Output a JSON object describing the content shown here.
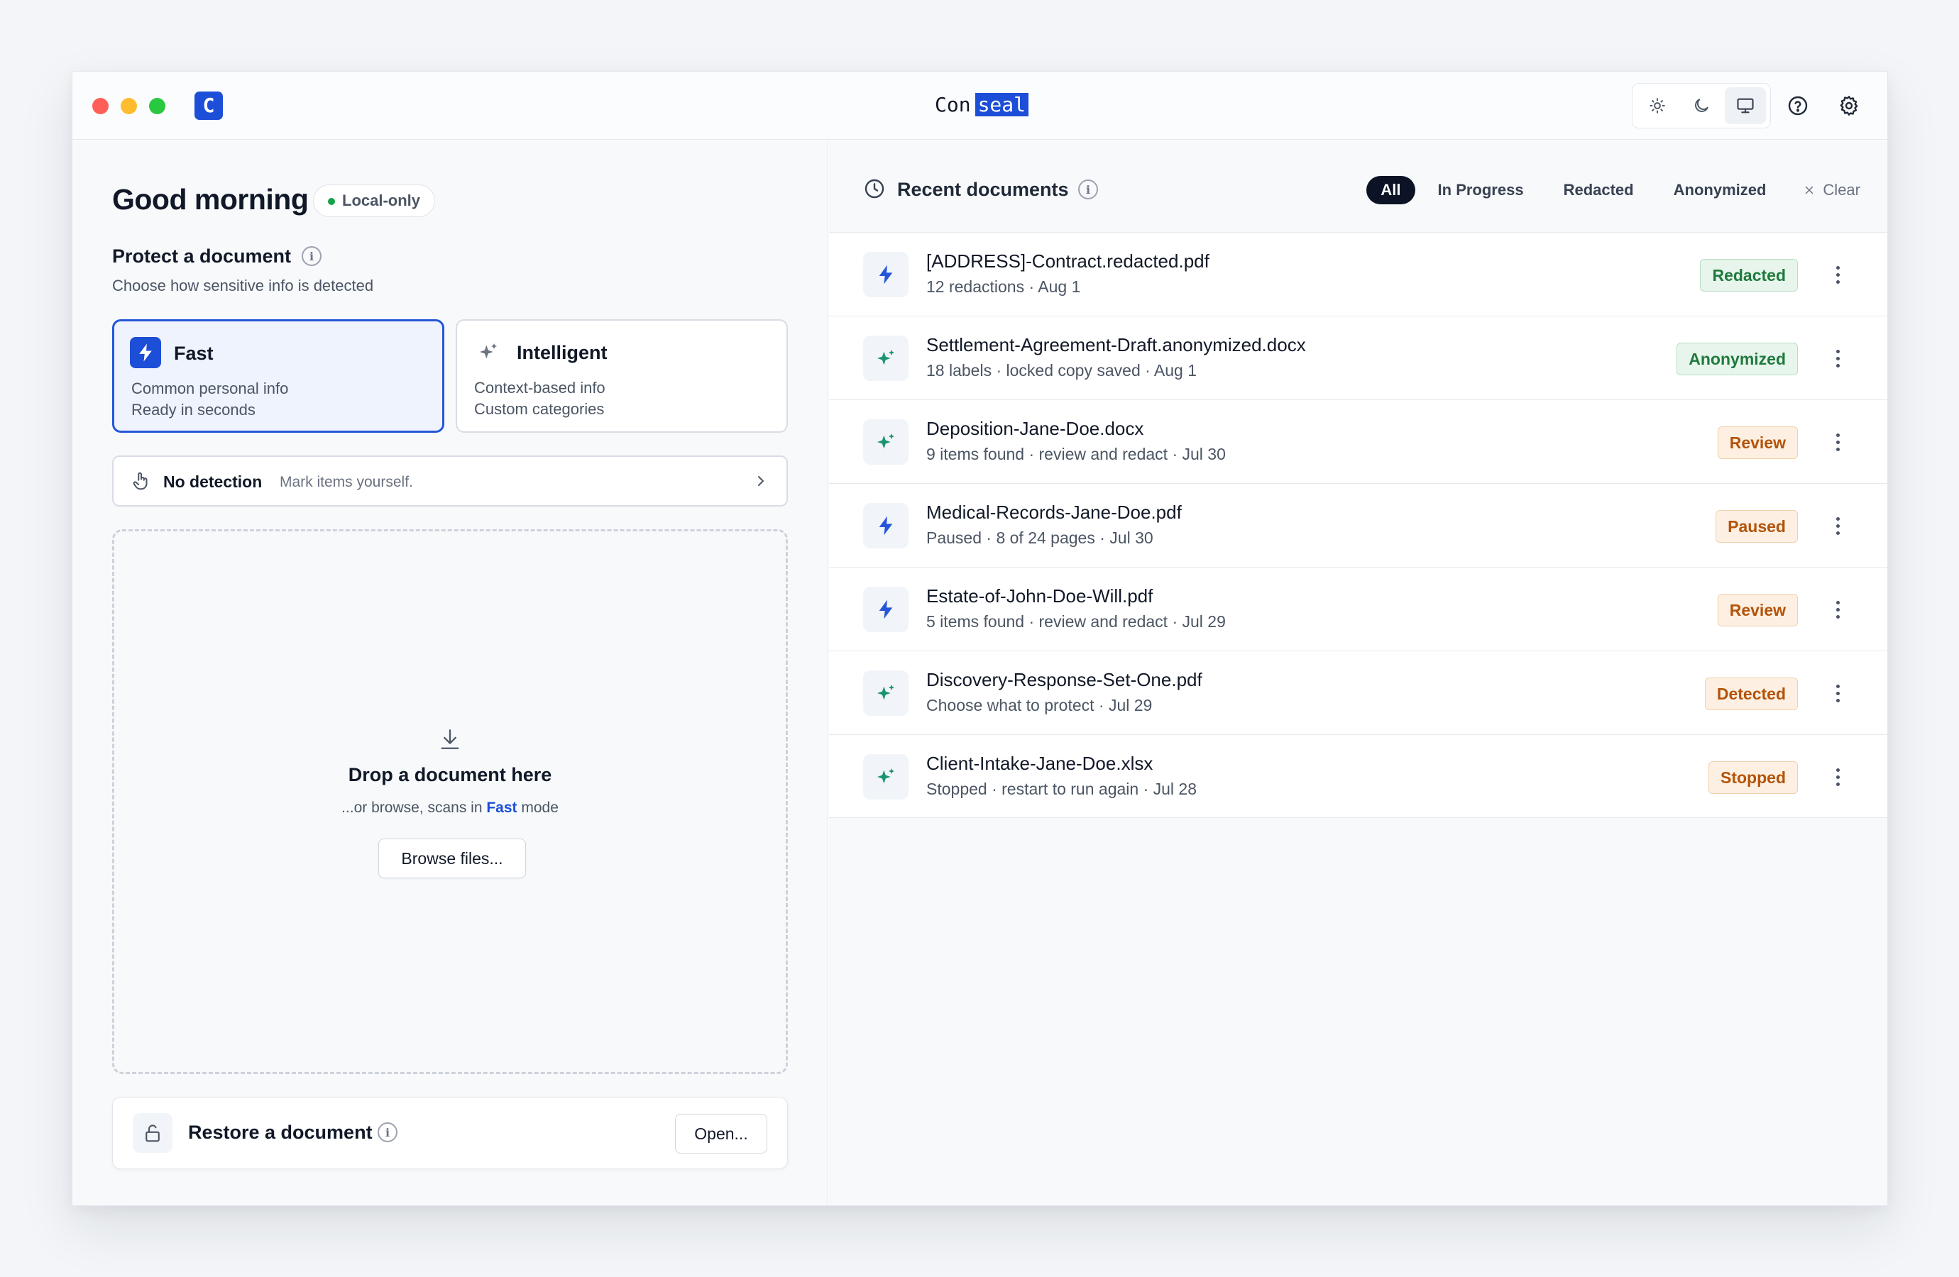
{
  "titlebar": {
    "logo_letter": "C",
    "title_plain": "Con",
    "title_highlight": "seal"
  },
  "left": {
    "greeting": "Good morning",
    "privacy_badge": "Local-only",
    "protect_title": "Protect a document",
    "protect_subtitle": "Choose how sensitive info is detected",
    "modes": [
      {
        "name": "Fast",
        "line1": "Common personal info",
        "line2": "Ready in seconds",
        "selected": true
      },
      {
        "name": "Intelligent",
        "line1": "Context-based info",
        "line2": "Custom categories",
        "selected": false
      }
    ],
    "no_detection": {
      "title": "No detection",
      "subtitle": "Mark items yourself."
    },
    "dropzone": {
      "title": "Drop a document here",
      "sub_prefix": "...or browse, scans in ",
      "sub_mode": "Fast",
      "sub_suffix": " mode",
      "browse_label": "Browse files..."
    },
    "restore": {
      "title": "Restore a document",
      "open_label": "Open..."
    }
  },
  "right": {
    "title": "Recent documents",
    "filters": [
      "All",
      "In Progress",
      "Redacted",
      "Anonymized"
    ],
    "active_filter": "All",
    "clear_label": "Clear",
    "documents": [
      {
        "name": "[ADDRESS]-Contract.redacted.pdf",
        "meta": "12 redactions · Aug 1",
        "status": "Redacted",
        "tone": "green",
        "mode_icon": "bolt-icon"
      },
      {
        "name": "Settlement-Agreement-Draft.anonymized.docx",
        "meta": "18 labels · locked copy saved · Aug 1",
        "status": "Anonymized",
        "tone": "green",
        "mode_icon": "sparkle-icon"
      },
      {
        "name": "Deposition-Jane-Doe.docx",
        "meta": "9 items found · review and redact · Jul 30",
        "status": "Review",
        "tone": "orange",
        "mode_icon": "sparkle-icon"
      },
      {
        "name": "Medical-Records-Jane-Doe.pdf",
        "meta": "Paused · 8 of 24 pages · Jul 30",
        "status": "Paused",
        "tone": "orange",
        "mode_icon": "bolt-icon"
      },
      {
        "name": "Estate-of-John-Doe-Will.pdf",
        "meta": "5 items found · review and redact · Jul 29",
        "status": "Review",
        "tone": "orange",
        "mode_icon": "bolt-icon"
      },
      {
        "name": "Discovery-Response-Set-One.pdf",
        "meta": "Choose what to protect · Jul 29",
        "status": "Detected",
        "tone": "orange",
        "mode_icon": "sparkle-icon"
      },
      {
        "name": "Client-Intake-Jane-Doe.xlsx",
        "meta": "Stopped · restart to run again · Jul 28",
        "status": "Stopped",
        "tone": "orange",
        "mode_icon": "sparkle-icon"
      }
    ]
  },
  "colors": {
    "accent": "#1d4ed8",
    "bolt": "#2556d9",
    "sparkle": "#199473",
    "status_green": "#1f7a3d",
    "status_orange": "#b45309"
  }
}
